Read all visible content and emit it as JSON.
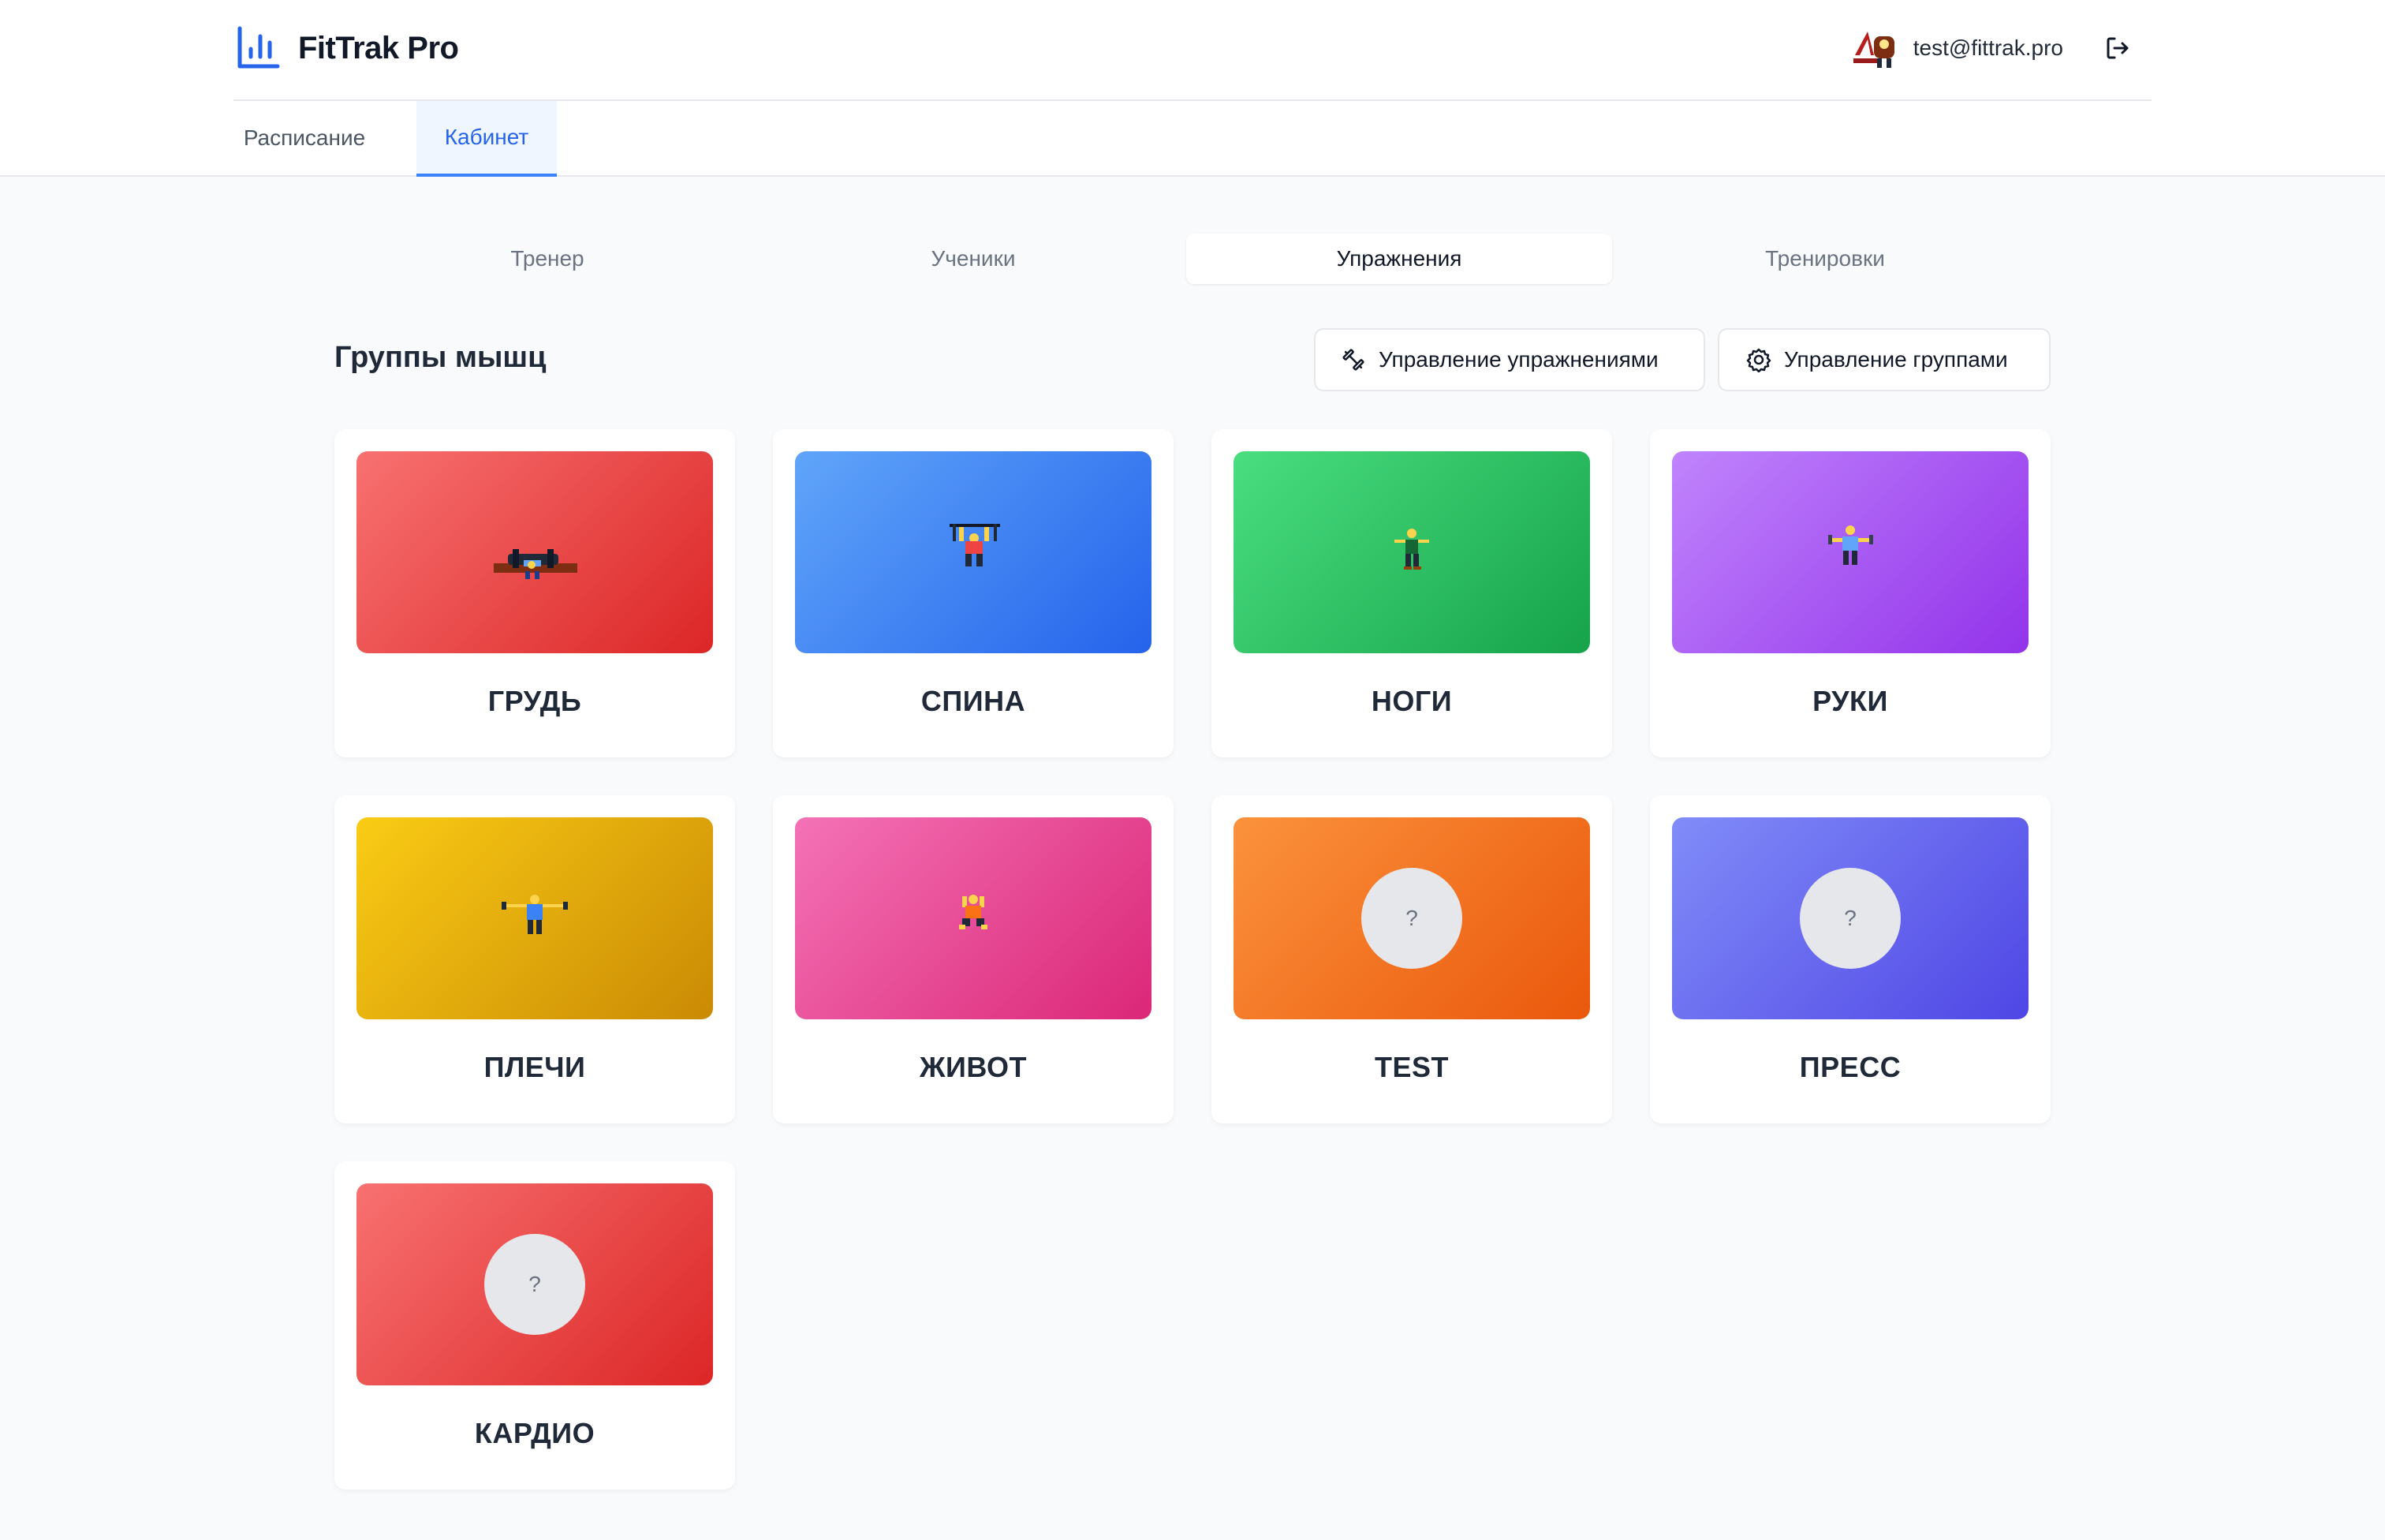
{
  "app": {
    "title": "FitTrak Pro"
  },
  "user": {
    "email": "test@fittrak.pro"
  },
  "nav": {
    "tabs": [
      {
        "label": "Расписание"
      },
      {
        "label": "Кабинет",
        "active": true
      }
    ]
  },
  "subtabs": [
    {
      "label": "Тренер"
    },
    {
      "label": "Ученики"
    },
    {
      "label": "Упражнения",
      "active": true
    },
    {
      "label": "Тренировки"
    }
  ],
  "section": {
    "title": "Группы мышц",
    "manage_exercises_label": "Управление упражнениями",
    "manage_groups_label": "Управление группами"
  },
  "groups": [
    {
      "label": "ГРУДЬ",
      "from": "#f87171",
      "to": "#dc2626",
      "icon": "bench-press-figure"
    },
    {
      "label": "СПИНА",
      "from": "#60a5fa",
      "to": "#2563eb",
      "icon": "pull-up-figure"
    },
    {
      "label": "НОГИ",
      "from": "#4ade80",
      "to": "#16a34a",
      "icon": "squat-figure"
    },
    {
      "label": "РУКИ",
      "from": "#c084fc",
      "to": "#9333ea",
      "icon": "curl-figure"
    },
    {
      "label": "ПЛЕЧИ",
      "from": "#facc15",
      "to": "#ca8a04",
      "icon": "lateral-raise-figure"
    },
    {
      "label": "ЖИВОТ",
      "from": "#f472b6",
      "to": "#db2777",
      "icon": "crunch-figure"
    },
    {
      "label": "TEST",
      "from": "#fb923c",
      "to": "#ea580c",
      "placeholder": "?"
    },
    {
      "label": "ПРЕСС",
      "from": "#818cf8",
      "to": "#4f46e5",
      "placeholder": "?"
    },
    {
      "label": "КАРДИО",
      "from": "#f87171",
      "to": "#dc2626",
      "placeholder": "?"
    }
  ]
}
